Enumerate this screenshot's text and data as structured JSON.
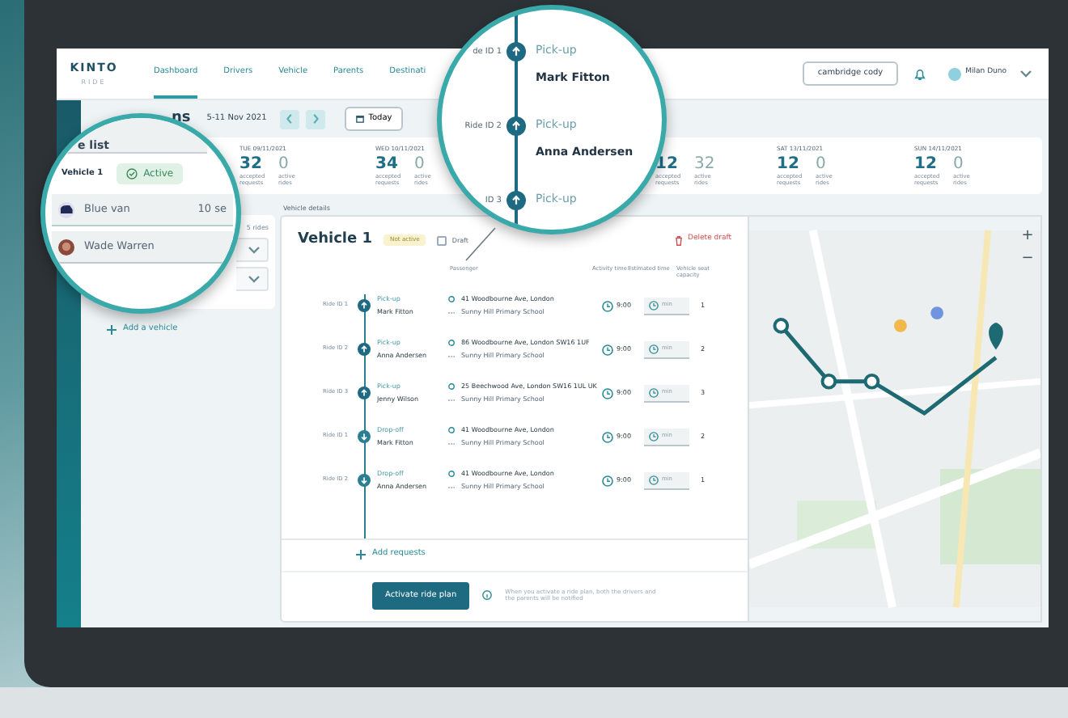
{
  "header": {
    "logo": "KINTO",
    "logo_sub": "RIDE",
    "tabs": [
      {
        "label": "Dashboard",
        "selected": true
      },
      {
        "label": "Drivers",
        "selected": false
      },
      {
        "label": "Vehicle",
        "selected": false
      },
      {
        "label": "Parents",
        "selected": false
      },
      {
        "label": "Destinati",
        "selected": false
      }
    ],
    "account_button": "cambridge cody",
    "user": "Milan Duno"
  },
  "week": {
    "title": "ns",
    "range": "5-11 Nov 2021",
    "today": "Today"
  },
  "days": [
    {
      "day": "TUE",
      "date": "09/11/2021",
      "accepted": "32",
      "accepted_label": "accepted requests",
      "active": "0",
      "active_label": "active rides"
    },
    {
      "day": "WED",
      "date": "10/11/2021",
      "accepted": "34",
      "accepted_label": "accepted requests",
      "active": "0",
      "active_label": "active rides"
    },
    {
      "accepted": "12",
      "accepted_label": "accepted requests",
      "active": "32",
      "active_label": "active rides"
    },
    {
      "day": "SAT",
      "date": "13/11/2021",
      "accepted": "12",
      "accepted_label": "accepted requests",
      "active": "0",
      "active_label": "active rides"
    },
    {
      "day": "SUN",
      "date": "14/11/2021",
      "accepted": "12",
      "accepted_label": "accepted requests",
      "active": "0",
      "active_label": "active rides"
    }
  ],
  "vehicle_list": {
    "rides": "5 rides",
    "add": "Add a vehicle"
  },
  "details": {
    "label": "Vehicle details",
    "title": "Vehicle 1",
    "status": "Not active",
    "status_active": false,
    "draft": {
      "label": "Draft",
      "checked": false
    },
    "delete": "Delete draft",
    "columns": [
      "Passenger",
      "Activity time",
      "Estimated time",
      "Vehicle seat capacity"
    ],
    "rides": [
      {
        "ride_id": "Ride ID 1",
        "kind": "pickup",
        "action": "Pick-up",
        "name": "Mark Fitton",
        "address": "41 Woodbourne Ave, London",
        "destination": "Sunny Hill Primary School",
        "time": "9:00",
        "estimate": "min",
        "seats": "1"
      },
      {
        "ride_id": "Ride ID 2",
        "kind": "pickup",
        "action": "Pick-up",
        "name": "Anna Andersen",
        "address": "86 Woodbourne Ave, London SW16 1UF",
        "destination": "Sunny Hill Primary School",
        "time": "9:00",
        "estimate": "min",
        "seats": "2"
      },
      {
        "ride_id": "Ride ID 3",
        "kind": "pickup",
        "action": "Pick-up",
        "name": "Jenny Wilson",
        "address": "25 Beechwood Ave, London SW16 1UL UK",
        "destination": "Sunny Hill Primary School",
        "time": "9:00",
        "estimate": "min",
        "seats": "3"
      },
      {
        "ride_id": "Ride ID 1",
        "kind": "dropoff",
        "action": "Drop-off",
        "name": "Mark Fitton",
        "address": "41 Woodbourne Ave, London",
        "destination": "Sunny Hill Primary School",
        "time": "9:00",
        "estimate": "min",
        "seats": "2"
      },
      {
        "ride_id": "Ride ID 2",
        "kind": "dropoff",
        "action": "Drop-off",
        "name": "Anna Andersen",
        "address": "41 Woodbourne Ave, London",
        "destination": "Sunny Hill Primary School",
        "time": "9:00",
        "estimate": "min",
        "seats": "1"
      }
    ],
    "add": "Add requests",
    "activate": "Activate ride plan",
    "note": "When you activate a ride plan, both the drivers and the parents will be notified"
  },
  "map": {
    "kind": "picture",
    "zoom_in": "+",
    "zoom_out": "−"
  },
  "callout_list": {
    "title": "e list",
    "vehicle": "Vehicle 1",
    "status": "Active",
    "active": true,
    "items": [
      {
        "kind": "vehicle",
        "name": "Blue van",
        "seats": "10 se"
      },
      {
        "kind": "person",
        "name": "Wade Warren"
      }
    ]
  },
  "callout_rides": [
    {
      "ride_id": "de ID 1",
      "kind": "pickup",
      "action": "Pick-up",
      "name": "Mark Fitton"
    },
    {
      "ride_id": "Ride ID 2",
      "kind": "pickup",
      "action": "Pick-up",
      "name": "Anna Andersen"
    },
    {
      "ride_id": "ID 3",
      "kind": "pickup",
      "action": "Pick-up"
    }
  ]
}
